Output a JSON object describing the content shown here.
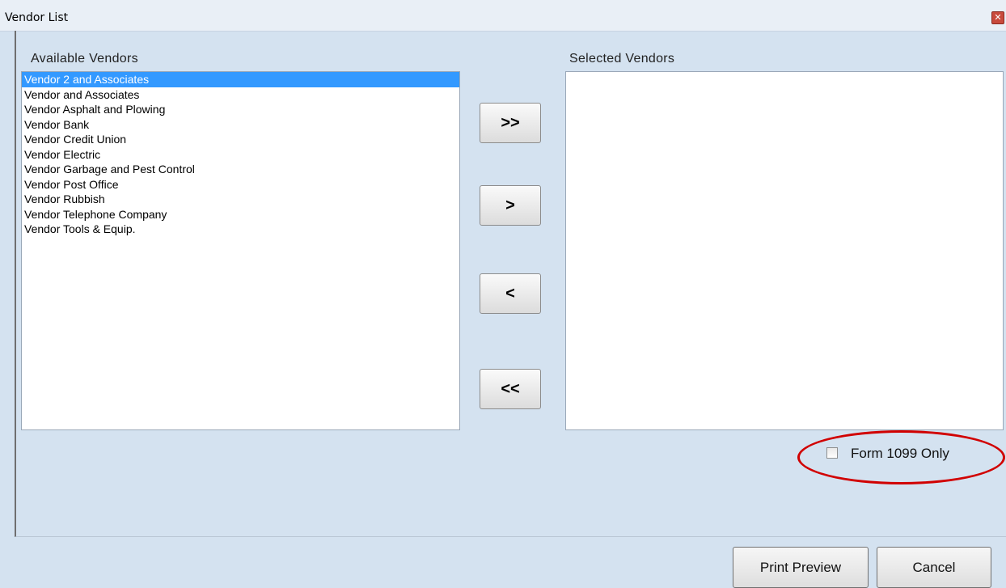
{
  "window": {
    "title": "Vendor List",
    "close_glyph": "✕"
  },
  "available": {
    "label": "Available Vendors",
    "items": [
      "Vendor 2 and Associates",
      "Vendor and Associates",
      "Vendor Asphalt and Plowing",
      "Vendor Bank",
      "Vendor Credit Union",
      "Vendor Electric",
      "Vendor Garbage and Pest Control",
      "Vendor Post Office",
      "Vendor Rubbish",
      "Vendor Telephone Company",
      "Vendor Tools & Equip."
    ],
    "selected_item": "Vendor 2 and Associates"
  },
  "selected": {
    "label": "Selected Vendors",
    "items": []
  },
  "move_buttons": {
    "add_all": ">>",
    "add_one": ">",
    "remove_one": "<",
    "remove_all": "<<"
  },
  "form1099": {
    "label": "Form 1099 Only",
    "checked": false
  },
  "footer": {
    "print_preview": "Print Preview",
    "cancel": "Cancel"
  },
  "colors": {
    "selection": "#3399ff",
    "annotation": "#d10000"
  }
}
